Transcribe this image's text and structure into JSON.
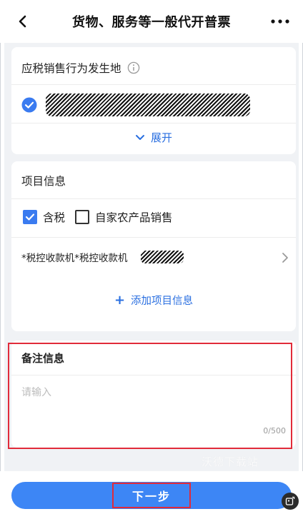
{
  "header": {
    "title": "货物、服务等一般代开普票",
    "back_icon": "chevron-left-icon",
    "more_icon": "more-dots-icon"
  },
  "section_location": {
    "label": "应税销售行为发生地",
    "info_icon": "info-icon",
    "selected": true,
    "expand_label": "展开"
  },
  "section_items": {
    "title": "项目信息",
    "checkbox_tax_included": {
      "label": "含税",
      "checked": true
    },
    "checkbox_self_produced": {
      "label": "自家农产品销售",
      "checked": false
    },
    "item_name": "*税控收款机*税控收款机",
    "add_label": "添加项目信息",
    "add_prefix": "+"
  },
  "section_remark": {
    "title": "备注信息",
    "placeholder": "请输入",
    "value": "",
    "counter": "0/500"
  },
  "footer": {
    "next_label": "下一步"
  },
  "watermark": "沃德下载站",
  "colors": {
    "accent": "#3d86f5",
    "link": "#2a6fe0",
    "highlight_red": "#e12b3a",
    "page_bg": "#f0f2f5"
  }
}
